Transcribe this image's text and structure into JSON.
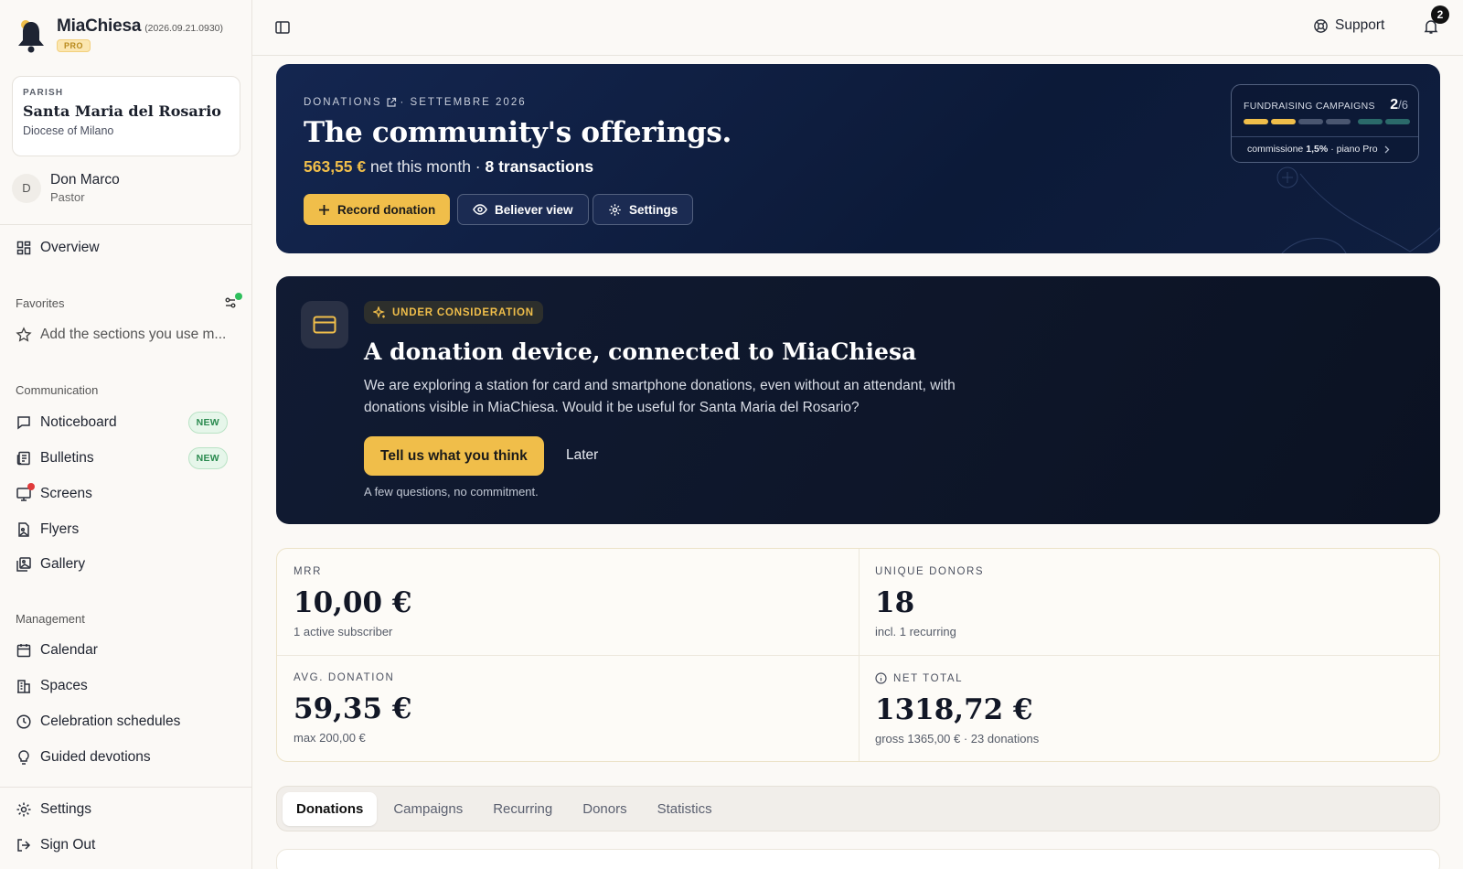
{
  "app": {
    "name": "MiaChiesa",
    "version": "(2026.09.21.0930)",
    "plan_badge": "PRO"
  },
  "parish": {
    "label": "PARISH",
    "name": "Santa Maria del Rosario",
    "diocese": "Diocese of Milano"
  },
  "user": {
    "initial": "D",
    "name": "Don Marco",
    "role": "Pastor"
  },
  "sidebar": {
    "overview": "Overview",
    "favorites_label": "Favorites",
    "favorites_hint": "Add the sections you use m...",
    "communication_label": "Communication",
    "communication": [
      {
        "label": "Noticeboard",
        "badge": "NEW"
      },
      {
        "label": "Bulletins",
        "badge": "NEW"
      },
      {
        "label": "Screens"
      },
      {
        "label": "Flyers"
      },
      {
        "label": "Gallery"
      }
    ],
    "management_label": "Management",
    "management": [
      {
        "label": "Calendar"
      },
      {
        "label": "Spaces"
      },
      {
        "label": "Celebration schedules"
      },
      {
        "label": "Guided devotions"
      }
    ],
    "settings": "Settings",
    "sign_out": "Sign Out"
  },
  "topbar": {
    "support": "Support",
    "notification_count": "2"
  },
  "hero": {
    "section": "DONATIONS",
    "period": "· SETTEMBRE 2026",
    "title": "The community's offerings.",
    "net_amount": "563,55 €",
    "net_text": "net this month ·",
    "transactions": "8 transactions",
    "buttons": {
      "record": "Record donation",
      "believer": "Believer view",
      "settings": "Settings"
    },
    "campaigns": {
      "label": "FUNDRAISING CAMPAIGNS",
      "count": "2",
      "total": "/6",
      "commission_prefix": "commissione",
      "commission_value": "1,5%",
      "plan": "· piano Pro",
      "bar_colors": [
        "#f0be4a",
        "#f0be4a",
        "#4a5670",
        "#4a5670",
        "#2b6a6a",
        "#2b6a6a"
      ]
    }
  },
  "banner": {
    "badge": "UNDER CONSIDERATION",
    "title": "A donation device, connected to MiaChiesa",
    "body_line1": "We are exploring a station for card and smartphone donations, even without an attendant, with",
    "body_line2": "donations visible in MiaChiesa. Would it be useful for Santa Maria del Rosario?",
    "cta": "Tell us what you think",
    "later": "Later",
    "note": "A few questions, no commitment."
  },
  "stats": {
    "mrr": {
      "label": "MRR",
      "value": "10,00 €",
      "sub": "1 active subscriber"
    },
    "donors": {
      "label": "UNIQUE DONORS",
      "value": "18",
      "sub": "incl. 1 recurring"
    },
    "avg": {
      "label": "AVG. DONATION",
      "value": "59,35 €",
      "sub": "max 200,00 €"
    },
    "net": {
      "label": "NET TOTAL",
      "value": "1318,72 €",
      "sub": "gross 1365,00 € · 23 donations"
    }
  },
  "tabs": [
    "Donations",
    "Campaigns",
    "Recurring",
    "Donors",
    "Statistics"
  ],
  "colors": {
    "accent": "#f0be4a",
    "navy": "#0f1e3f",
    "online": "#2fbf5c",
    "alert": "#e03a3a"
  }
}
